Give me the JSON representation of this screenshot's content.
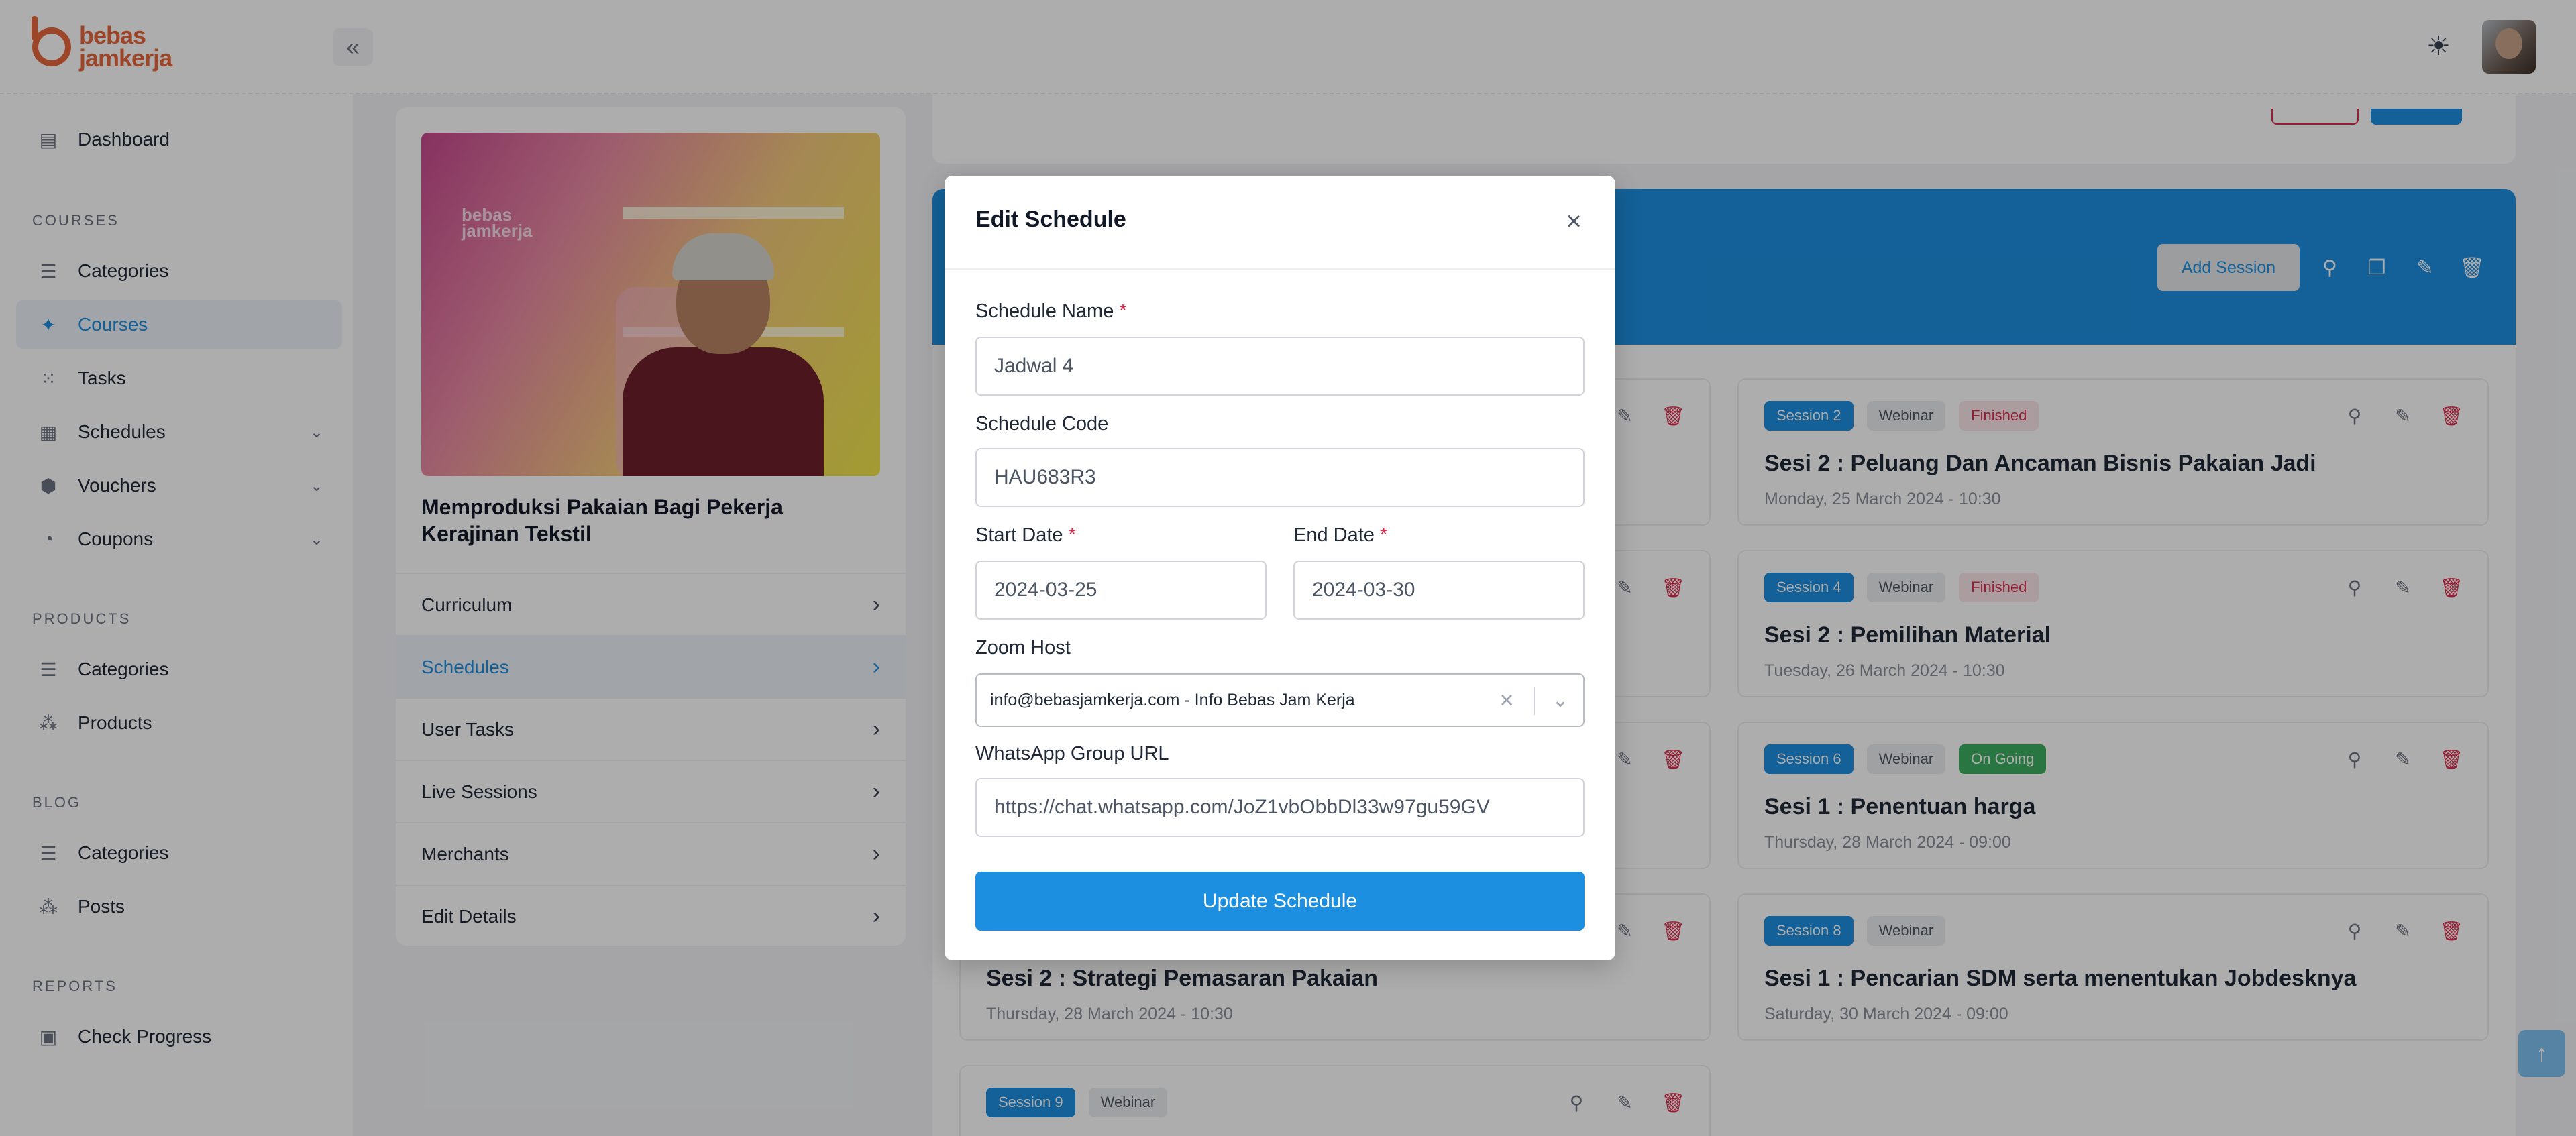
{
  "brand": {
    "logo_text_1": "bebas",
    "logo_text_2": "jamkerja"
  },
  "sidebar": {
    "dashboard": "Dashboard",
    "section_courses": "COURSES",
    "courses_items": [
      "Categories",
      "Courses",
      "Tasks",
      "Schedules",
      "Vouchers",
      "Coupons"
    ],
    "section_products": "PRODUCTS",
    "products_items": [
      "Categories",
      "Products"
    ],
    "section_blog": "BLOG",
    "blog_items": [
      "Categories",
      "Posts"
    ],
    "section_reports": "REPORTS",
    "reports_items": [
      "Check Progress"
    ]
  },
  "course": {
    "image_watermark_1": "bebas",
    "image_watermark_2": "jamkerja",
    "title": "Memproduksi Pakaian Bagi Pekerja Kerajinan Tekstil",
    "menu": [
      "Curriculum",
      "Schedules",
      "User Tasks",
      "Live Sessions",
      "Merchants",
      "Edit Details"
    ]
  },
  "schedule_header": {
    "add_session": "Add Session"
  },
  "sessions": [
    {
      "badge": "Session 2",
      "type": "Webinar",
      "status": "Finished",
      "title": "Sesi 2 : Peluang Dan Ancaman Bisnis Pakaian Jadi",
      "date": "Monday, 25 March 2024 - 10:30"
    },
    {
      "badge": "Session 4",
      "type": "Webinar",
      "status": "Finished",
      "title": "Sesi 2 : Pemilihan Material",
      "date": "Tuesday, 26 March 2024 - 10:30"
    },
    {
      "badge": "Session 6",
      "type": "Webinar",
      "status": "On Going",
      "title": "Sesi 1 : Penentuan harga",
      "date": "Thursday, 28 March 2024 - 09:00"
    },
    {
      "badge": "Session 8",
      "type": "Webinar",
      "status": "",
      "title": "Sesi 1 : Pencarian SDM serta menentukan Jobdesknya",
      "date": "Saturday, 30 March 2024 - 09:00"
    },
    {
      "badge": "",
      "type": "",
      "status": "",
      "title": "Sesi 2 : Strategi Pemasaran Pakaian",
      "date": "Thursday, 28 March 2024 - 10:30"
    },
    {
      "badge": "Session 9",
      "type": "Webinar",
      "status": "",
      "title": "",
      "date": ""
    }
  ],
  "modal": {
    "title": "Edit Schedule",
    "name_label": "Schedule Name",
    "name_value": "Jadwal 4",
    "code_label": "Schedule Code",
    "code_value": "HAU683R3",
    "start_label": "Start Date",
    "start_value": "2024-03-25",
    "end_label": "End Date",
    "end_value": "2024-03-30",
    "zoom_label": "Zoom Host",
    "zoom_value": "info@bebasjamkerja.com - Info Bebas Jam Kerja",
    "wa_label": "WhatsApp Group URL",
    "wa_value": "https://chat.whatsapp.com/JoZ1vbObbDl33w97gu59GV",
    "required_mark": "*",
    "submit": "Update Schedule"
  },
  "colors": {
    "accent": "#1d8fe0",
    "brand": "#e8663b",
    "danger": "#dc2a4a",
    "success": "#3fae62"
  }
}
